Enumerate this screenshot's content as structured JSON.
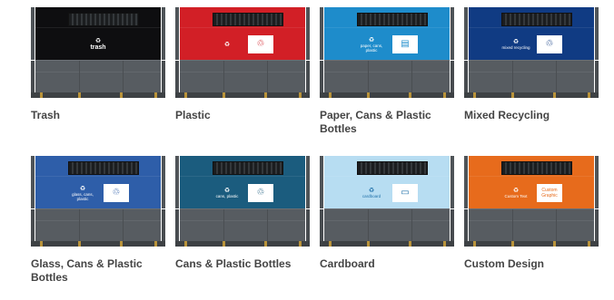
{
  "products": [
    {
      "name": "Trash",
      "color": "#0e0e10",
      "icon": "trash-icon",
      "bin_text": "trash",
      "panel_glyph": ""
    },
    {
      "name": "Plastic",
      "color": "#d21f26",
      "icon": "plastic-bottle-icon",
      "bin_text": "",
      "panel_glyph": "♲"
    },
    {
      "name": "Paper, Cans & Plastic Bottles",
      "color": "#1e8ccb",
      "icon": "paper-cans-plastic-icon",
      "bin_text": "paper, cans, plastic",
      "panel_glyph": "▤"
    },
    {
      "name": "Mixed Recycling",
      "color": "#103b83",
      "icon": "mixed-recycling-icon",
      "bin_text": "mixed recycling",
      "panel_glyph": "♲"
    },
    {
      "name": "Glass, Cans & Plastic Bottles",
      "color": "#2e5ea9",
      "icon": "glass-cans-plastic-icon",
      "bin_text": "glass, cans, plastic",
      "panel_glyph": "♲"
    },
    {
      "name": "Cans & Plastic Bottles",
      "color": "#1b5c7e",
      "icon": "cans-plastic-icon",
      "bin_text": "cans, plastic",
      "panel_glyph": "♲"
    },
    {
      "name": "Cardboard",
      "color": "#b7ddf2",
      "icon": "cardboard-icon",
      "bin_text": "cardboard",
      "panel_glyph": "▭"
    },
    {
      "name": "Custom Design",
      "color": "#e76b1c",
      "icon": "custom-design-icon",
      "bin_text": "Custom Text",
      "panel_glyph": "Custom Graphic"
    }
  ]
}
